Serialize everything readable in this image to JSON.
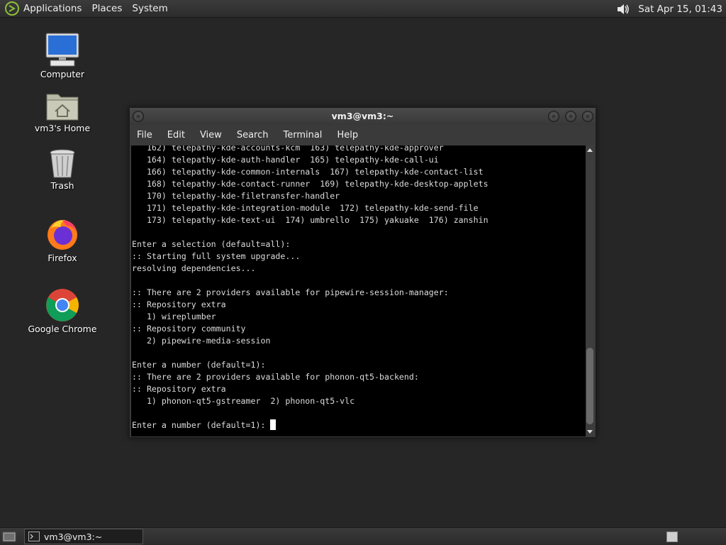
{
  "top_panel": {
    "menus": [
      "Applications",
      "Places",
      "System"
    ],
    "clock": "Sat Apr 15, 01:43"
  },
  "desktop_icons": [
    {
      "label": "Computer",
      "icon": "computer-icon"
    },
    {
      "label": "vm3's Home",
      "icon": "home-folder-icon"
    },
    {
      "label": "Trash",
      "icon": "trash-icon"
    },
    {
      "label": "Firefox",
      "icon": "firefox-icon"
    },
    {
      "label": "Google Chrome",
      "icon": "chrome-icon"
    }
  ],
  "terminal": {
    "title": "vm3@vm3:~",
    "menu": [
      "File",
      "Edit",
      "View",
      "Search",
      "Terminal",
      "Help"
    ],
    "lines": [
      "   162) telepathy-kde-accounts-kcm  163) telepathy-kde-approver",
      "   164) telepathy-kde-auth-handler  165) telepathy-kde-call-ui",
      "   166) telepathy-kde-common-internals  167) telepathy-kde-contact-list",
      "   168) telepathy-kde-contact-runner  169) telepathy-kde-desktop-applets",
      "   170) telepathy-kde-filetransfer-handler",
      "   171) telepathy-kde-integration-module  172) telepathy-kde-send-file",
      "   173) telepathy-kde-text-ui  174) umbrello  175) yakuake  176) zanshin",
      "",
      "Enter a selection (default=all):",
      ":: Starting full system upgrade...",
      "resolving dependencies...",
      "",
      ":: There are 2 providers available for pipewire-session-manager:",
      ":: Repository extra",
      "   1) wireplumber",
      ":: Repository community",
      "   2) pipewire-media-session",
      "",
      "Enter a number (default=1):",
      ":: There are 2 providers available for phonon-qt5-backend:",
      ":: Repository extra",
      "   1) phonon-qt5-gstreamer  2) phonon-qt5-vlc",
      ""
    ],
    "prompt": "Enter a number (default=1): "
  },
  "taskbar": {
    "window_label": "vm3@vm3:~"
  }
}
